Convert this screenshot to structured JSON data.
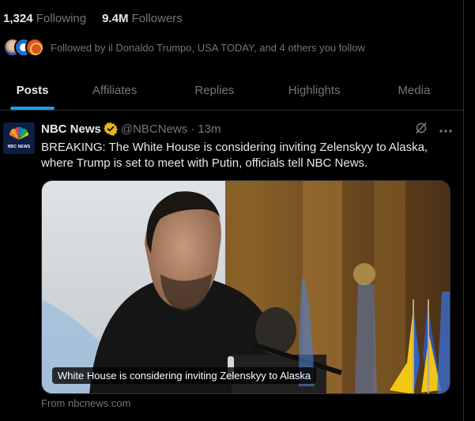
{
  "profile": {
    "following_count": "1,324",
    "following_label": "Following",
    "followers_count": "9.4M",
    "followers_label": "Followers",
    "followed_by_text": "Followed by il Donaldo Trumpo, USA TODAY, and 4 others you follow"
  },
  "tabs": [
    {
      "label": "Posts",
      "active": true
    },
    {
      "label": "Affiliates",
      "active": false
    },
    {
      "label": "Replies",
      "active": false
    },
    {
      "label": "Highlights",
      "active": false
    },
    {
      "label": "Media",
      "active": false
    }
  ],
  "tweet": {
    "author_name": "NBC News",
    "logo_text": "NBC NEWS",
    "handle": "@NBCNews",
    "separator": "·",
    "time": "13m",
    "text": "BREAKING: The White House is considering inviting Zelenskyy to Alaska, where Trump is set to meet with Putin, officials tell NBC News.",
    "card_caption": "White House is considering inviting Zelenskyy to Alaska",
    "source": "From nbcnews.com"
  },
  "colors": {
    "accent": "#1d9bf0",
    "verified_gold": "#e2b719",
    "muted_text": "#71767b"
  },
  "icons": {
    "verified": "gold-check-badge-icon",
    "grok": "grok-icon",
    "more": "more-icon"
  }
}
